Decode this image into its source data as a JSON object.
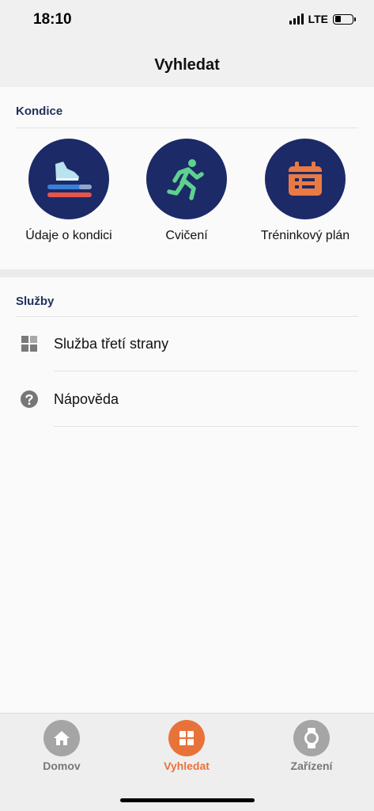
{
  "status_bar": {
    "time": "18:10",
    "network": "LTE"
  },
  "header": {
    "title": "Vyhledat"
  },
  "kondice": {
    "title": "Kondice",
    "tiles": [
      {
        "label": "Údaje o kondici",
        "icon": "running-shoe-icon"
      },
      {
        "label": "Cvičení",
        "icon": "runner-icon"
      },
      {
        "label": "Tréninkový plán",
        "icon": "calendar-icon"
      }
    ]
  },
  "sluzby": {
    "title": "Služby",
    "items": [
      {
        "label": "Služba třetí strany",
        "icon": "grid-icon"
      },
      {
        "label": "Nápověda",
        "icon": "help-icon"
      }
    ]
  },
  "tab_bar": {
    "tabs": [
      {
        "label": "Domov",
        "icon": "home-icon",
        "active": false
      },
      {
        "label": "Vyhledat",
        "icon": "grid-icon",
        "active": true
      },
      {
        "label": "Zařízení",
        "icon": "watch-icon",
        "active": false
      }
    ]
  },
  "colors": {
    "accent": "#e8733a",
    "tile_bg": "#1c2a68",
    "section_header": "#23305c",
    "inactive_tab": "#a0a0a0"
  }
}
